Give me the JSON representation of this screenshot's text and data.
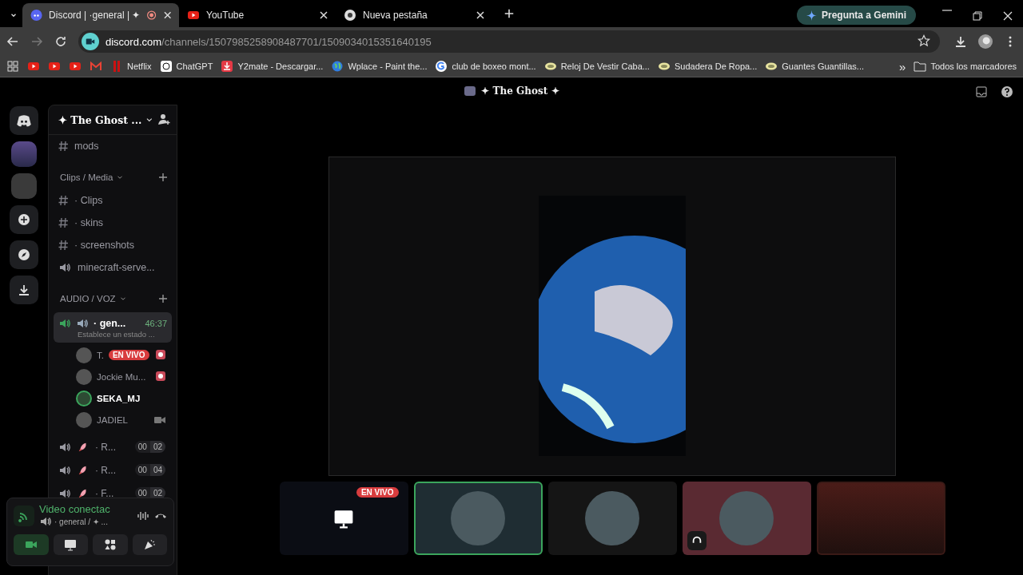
{
  "browser": {
    "tabs": [
      {
        "title": "Discord | ·general | ✦",
        "selected": true,
        "recording": true
      },
      {
        "title": "YouTube",
        "selected": false,
        "recording": false
      },
      {
        "title": "Nueva pestaña",
        "selected": false,
        "recording": false
      }
    ],
    "gemini": "Pregunta a Gemini",
    "url_host": "discord.com",
    "url_path": "/channels/1507985258908487701/1509034015351640195",
    "bookmarks": [
      {
        "kind": "youtube"
      },
      {
        "kind": "youtube"
      },
      {
        "kind": "youtube"
      },
      {
        "kind": "gmail"
      },
      {
        "kind": "netflix",
        "label": "Netflix"
      },
      {
        "kind": "chatgpt",
        "label": "ChatGPT"
      },
      {
        "kind": "download",
        "label": "Y2mate - Descargar..."
      },
      {
        "kind": "globe",
        "label": "Wplace - Paint the..."
      },
      {
        "kind": "google",
        "label": "club de boxeo mont..."
      },
      {
        "kind": "shop",
        "label": "Reloj De Vestir Caba..."
      },
      {
        "kind": "shop",
        "label": "Sudadera De Ropa..."
      },
      {
        "kind": "shop",
        "label": "Guantes Guantillas..."
      }
    ],
    "more": "»",
    "all_bookmarks": "Todos los marcadores"
  },
  "discord": {
    "title": "✦ The Ghost ✦",
    "server_name": "✦ The Ghost ...",
    "channels": [
      {
        "kind": "text",
        "name": "mods"
      },
      {
        "kind": "category",
        "name": "Clips / Media"
      },
      {
        "kind": "text",
        "name": "· Clips"
      },
      {
        "kind": "text",
        "name": "· skins"
      },
      {
        "kind": "text",
        "name": "· screenshots"
      },
      {
        "kind": "voice",
        "name": "minecraft-serve..."
      },
      {
        "kind": "category",
        "name": "AUDIO / VOZ"
      }
    ],
    "active_voice": {
      "name": "· gen...",
      "timer": "46:37",
      "status": "Establece un estado ...",
      "selected": true
    },
    "members": [
      {
        "name": "T.",
        "badge": "EN VIVO",
        "speaking": false,
        "video": false,
        "activity": true
      },
      {
        "name": "Jockie Mu...",
        "speaking": false,
        "video": false,
        "activity": true
      },
      {
        "name": "SEKA_MJ",
        "speaking": true,
        "video": false,
        "activity": false
      },
      {
        "name": "JADIEL",
        "speaking": false,
        "video": true,
        "activity": false
      }
    ],
    "voice_channels": [
      {
        "name": "· R...",
        "count_a": "00",
        "count_b": "02"
      },
      {
        "name": "· R...",
        "count_a": "00",
        "count_b": "04"
      },
      {
        "name": "· F...",
        "count_a": "00",
        "count_b": "02"
      }
    ],
    "voice_panel": {
      "status": "Video conectac",
      "channel": "· general / ✦ ...",
      "camera_on": true
    },
    "tiles": [
      {
        "kind": "stream",
        "badge": "EN VIVO",
        "selected": false,
        "app_badge": false
      },
      {
        "kind": "avatar",
        "selected": true,
        "app_badge": false,
        "color": "#1f2d33"
      },
      {
        "kind": "avatar",
        "selected": false,
        "app_badge": false,
        "color": "#151515"
      },
      {
        "kind": "avatar",
        "selected": false,
        "app_badge": true,
        "color": "#5a2a32"
      },
      {
        "kind": "camera",
        "selected": false,
        "app_badge": false
      }
    ]
  }
}
